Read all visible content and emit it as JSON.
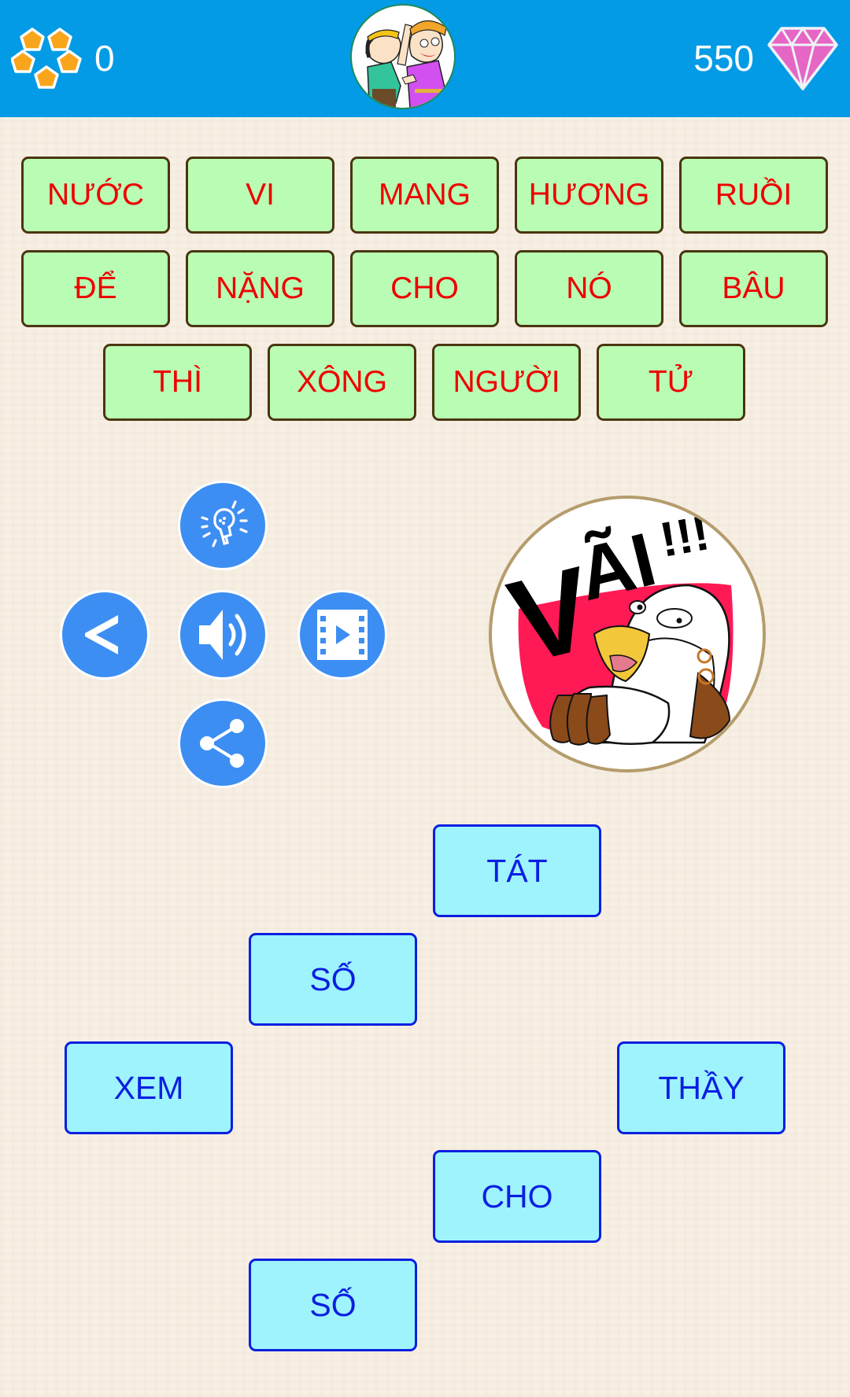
{
  "header": {
    "coin_count": "0",
    "gem_count": "550",
    "icons": {
      "coins": "pentagon-cluster-coins-icon",
      "avatar": "cartoon-characters-avatar",
      "gems": "pink-diamond-icon"
    }
  },
  "word_bank": [
    {
      "label": "NƯỚC"
    },
    {
      "label": "VI"
    },
    {
      "label": "MANG"
    },
    {
      "label": "HƯƠNG"
    },
    {
      "label": "RUỒI"
    },
    {
      "label": "ĐỂ"
    },
    {
      "label": "NẶNG"
    },
    {
      "label": "CHO"
    },
    {
      "label": "NÓ"
    },
    {
      "label": "BÂU"
    },
    {
      "label": "THÌ"
    },
    {
      "label": "XÔNG"
    },
    {
      "label": "NGƯỜI"
    },
    {
      "label": "TỬ"
    }
  ],
  "controls": {
    "hint": "lightbulb-hint-icon",
    "back": "chevron-left-icon",
    "sound": "speaker-icon",
    "video": "film-play-icon",
    "share": "share-icon"
  },
  "sticker": {
    "text": "VÃI !!!"
  },
  "answer_tiles": [
    {
      "label": "TÁT"
    },
    {
      "label": "SỐ"
    },
    {
      "label": "XEM"
    },
    {
      "label": "THẦY"
    },
    {
      "label": "CHO"
    },
    {
      "label": "SỐ"
    }
  ],
  "colors": {
    "header_bg": "#039be5",
    "word_tile_bg": "#b9fdb4",
    "word_tile_text": "#ee0000",
    "answer_tile_bg": "#9ef3fd",
    "answer_tile_text": "#0a1fe0",
    "control_bg": "#3d8ef2"
  }
}
